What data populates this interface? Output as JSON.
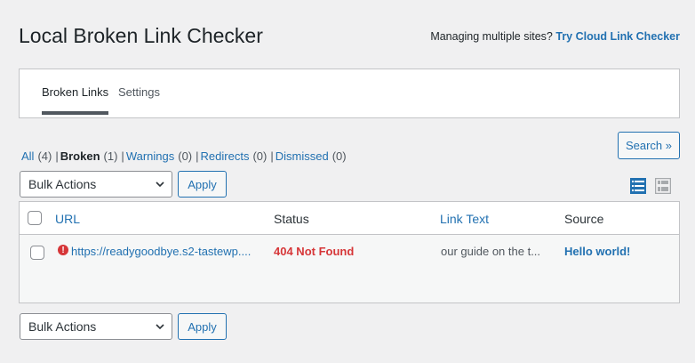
{
  "page": {
    "title": "Local Broken Link Checker",
    "promo_text": "Managing multiple sites?",
    "promo_link": "Try Cloud Link Checker"
  },
  "tabs": [
    {
      "label": "Broken Links",
      "active": true
    },
    {
      "label": "Settings",
      "active": false
    }
  ],
  "search_button": "Search »",
  "filters": [
    {
      "label": "All",
      "count": "(4)",
      "current": false
    },
    {
      "label": "Broken",
      "count": "(1)",
      "current": true
    },
    {
      "label": "Warnings",
      "count": "(0)",
      "current": false
    },
    {
      "label": "Redirects",
      "count": "(0)",
      "current": false
    },
    {
      "label": "Dismissed",
      "count": "(0)",
      "current": false
    }
  ],
  "bulk_actions": {
    "selected": "Bulk Actions",
    "apply_label": "Apply"
  },
  "table": {
    "columns": {
      "url": "URL",
      "status": "Status",
      "link_text": "Link Text",
      "source": "Source"
    },
    "rows": [
      {
        "url": "https://readygoodbye.s2-tastewp....",
        "status": "404 Not Found",
        "link_text": "our guide on the t...",
        "source": "Hello world!"
      }
    ]
  },
  "icons": {
    "error": "error-circle-icon",
    "list_view": "list-view-icon",
    "excerpt_view": "excerpt-view-icon",
    "dropdown": "chevron-down-icon"
  },
  "colors": {
    "link": "#2271b1",
    "error": "#d63638",
    "background": "#f0f0f1"
  }
}
